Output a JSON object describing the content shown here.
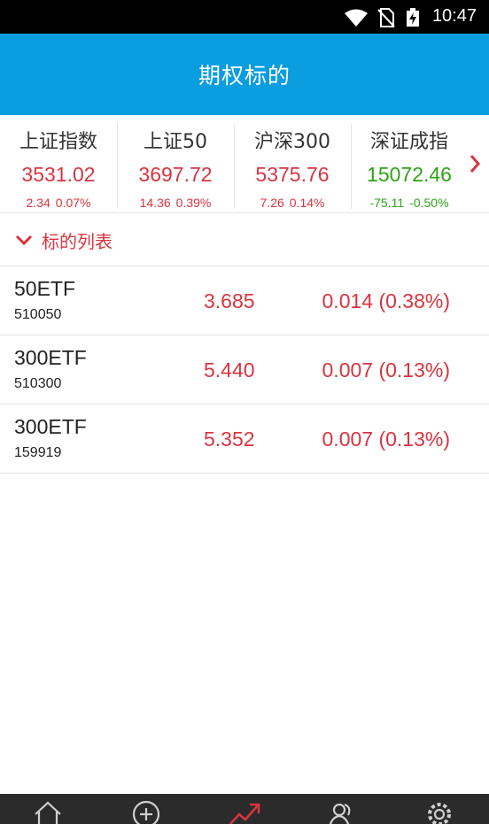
{
  "status_bar": {
    "time": "10:47",
    "icons": [
      "wifi-icon",
      "no-sim-icon",
      "battery-charging-icon"
    ]
  },
  "header": {
    "title": "期权标的"
  },
  "indices": [
    {
      "name": "上证指数",
      "value": "3531.02",
      "change": "2.34",
      "pct": "0.07%",
      "trend": "up"
    },
    {
      "name": "上证50",
      "value": "3697.72",
      "change": "14.36",
      "pct": "0.39%",
      "trend": "up"
    },
    {
      "name": "沪深300",
      "value": "5375.76",
      "change": "7.26",
      "pct": "0.14%",
      "trend": "up"
    },
    {
      "name": "深证成指",
      "value": "15072.46",
      "change": "-75.11",
      "pct": "-0.50%",
      "trend": "down"
    }
  ],
  "section": {
    "title": "标的列表",
    "icon": "chevron-down-icon"
  },
  "etfs": [
    {
      "name": "50ETF",
      "code": "510050",
      "price": "3.685",
      "change": "0.014 (0.38%)"
    },
    {
      "name": "300ETF",
      "code": "510300",
      "price": "5.440",
      "change": "0.007 (0.13%)"
    },
    {
      "name": "300ETF",
      "code": "159919",
      "price": "5.352",
      "change": "0.007 (0.13%)"
    }
  ],
  "tab_bar": {
    "tabs": [
      "home-icon",
      "add-circle-icon",
      "trend-icon",
      "users-icon",
      "settings-icon"
    ],
    "active": "trend-icon"
  },
  "colors": {
    "header_bg": "#0a9de0",
    "up": "#d9343f",
    "down": "#2ea318",
    "tab_active": "#d9343f",
    "tab_bar_bg": "#2b2b2b"
  }
}
